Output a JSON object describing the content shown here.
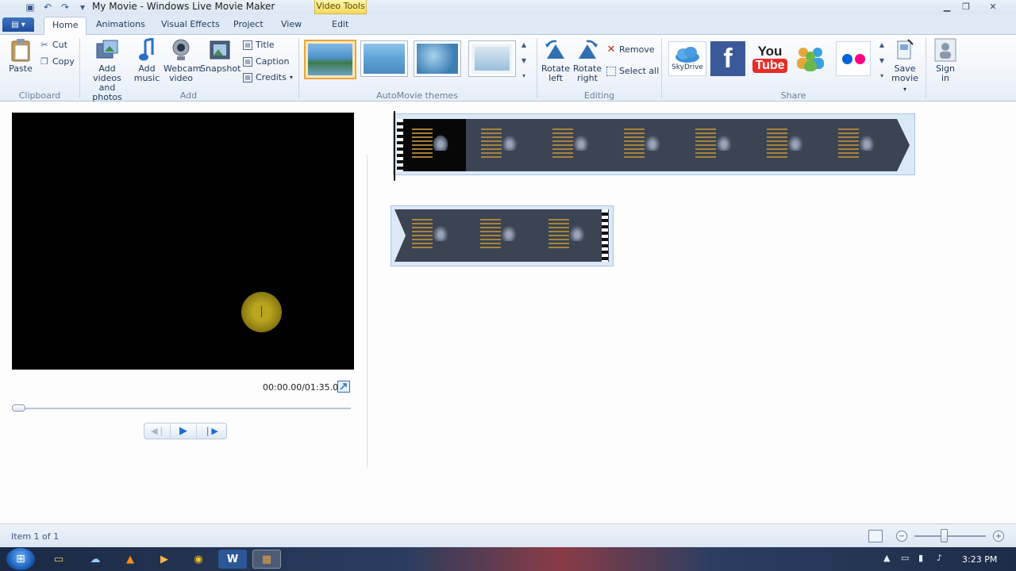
{
  "window": {
    "title": "My Movie - Windows Live Movie Maker",
    "context_tab": "Video Tools"
  },
  "tabs": [
    {
      "label": "Home",
      "active": true
    },
    {
      "label": "Animations",
      "active": false
    },
    {
      "label": "Visual Effects",
      "active": false
    },
    {
      "label": "Project",
      "active": false
    },
    {
      "label": "View",
      "active": false
    },
    {
      "label": "Edit",
      "active": false
    }
  ],
  "ribbon": {
    "clipboard": {
      "label": "Clipboard",
      "paste": "Paste",
      "cut": "Cut",
      "copy": "Copy"
    },
    "add": {
      "label": "Add",
      "add_videos": [
        "Add videos",
        "and photos"
      ],
      "add_music": [
        "Add",
        "music"
      ],
      "webcam": [
        "Webcam",
        "video"
      ],
      "snapshot": "Snapshot",
      "title": "Title",
      "caption": "Caption",
      "credits": "Credits"
    },
    "themes": {
      "label": "AutoMovie themes"
    },
    "editing": {
      "label": "Editing",
      "rotate_left": [
        "Rotate",
        "left"
      ],
      "rotate_right": [
        "Rotate",
        "right"
      ],
      "remove": "Remove",
      "select_all": "Select all"
    },
    "share": {
      "label": "Share",
      "skydrive": "SkyDrive",
      "youtube_you": "You",
      "youtube_tube": "Tube",
      "save_movie": [
        "Save",
        "movie"
      ],
      "sign_in": [
        "Sign",
        "in"
      ]
    }
  },
  "preview": {
    "time": "00:00.00/01:35.04",
    "seek_progress": 0.0
  },
  "status": {
    "text": "Item 1 of 1",
    "zoom_level": 0.45
  },
  "taskbar": {
    "clock": "3:23 PM"
  },
  "colors": {
    "ribbon_accent": "#1e4e9e",
    "selected_theme": "#e9a53c",
    "facebook": "#3b5998",
    "youtube_red": "#e52d27",
    "flickr_blue": "#0063dc",
    "flickr_pink": "#ff0084"
  }
}
